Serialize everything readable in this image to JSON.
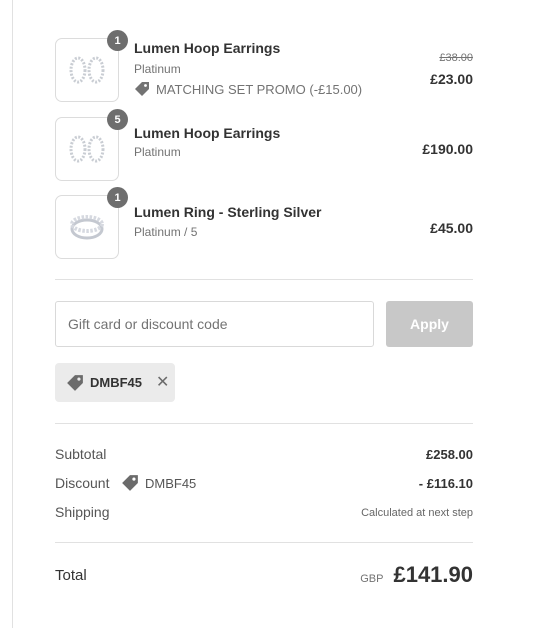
{
  "items": [
    {
      "qty": "1",
      "name": "Lumen Hoop Earrings",
      "variant": "Platinum",
      "promo": "MATCHING SET PROMO (-£15.00)",
      "price_original": "£38.00",
      "price": "£23.00",
      "image_icon": "hoop-earrings-image"
    },
    {
      "qty": "5",
      "name": "Lumen Hoop Earrings",
      "variant": "Platinum",
      "price": "£190.00",
      "image_icon": "hoop-earrings-image"
    },
    {
      "qty": "1",
      "name": "Lumen Ring - Sterling Silver",
      "variant": "Platinum / 5",
      "price": "£45.00",
      "image_icon": "ring-image"
    }
  ],
  "discount_form": {
    "placeholder": "Gift card or discount code",
    "value": "",
    "apply_label": "Apply"
  },
  "applied_code": {
    "code": "DMBF45",
    "remove_icon": "close-icon"
  },
  "summary": {
    "subtotal_label": "Subtotal",
    "subtotal_value": "£258.00",
    "discount_label": "Discount",
    "discount_code": "DMBF45",
    "discount_value": "- £116.10",
    "shipping_label": "Shipping",
    "shipping_value": "Calculated at next step"
  },
  "total": {
    "label": "Total",
    "currency": "GBP",
    "amount": "£141.90"
  },
  "colors": {
    "text": "#333333",
    "muted": "#737373",
    "badge": "#6e6e6e",
    "button_disabled": "#c8c8c8",
    "chip_bg": "#ebebeb",
    "divider": "#e1e1e1"
  }
}
